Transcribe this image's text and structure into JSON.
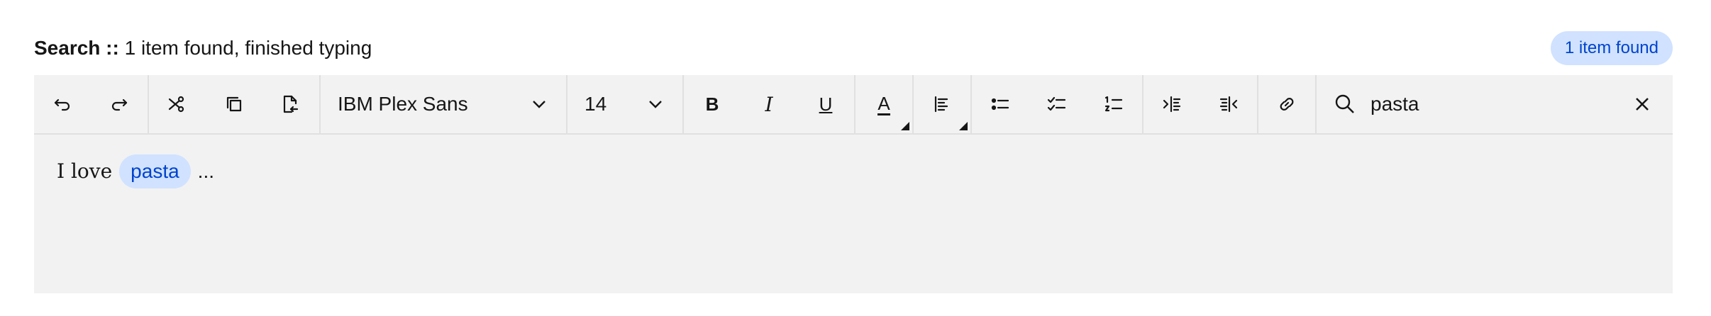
{
  "status": {
    "label": "Search ::",
    "text": "1 item found, finished typing"
  },
  "badge": "1 item found",
  "toolbar": {
    "font": "IBM Plex Sans",
    "size": "14",
    "bold": "B",
    "italic": "I",
    "underline": "U",
    "font_color": "A"
  },
  "search": {
    "query": "pasta"
  },
  "content": {
    "before": "I love",
    "highlight": "pasta",
    "after": "..."
  }
}
